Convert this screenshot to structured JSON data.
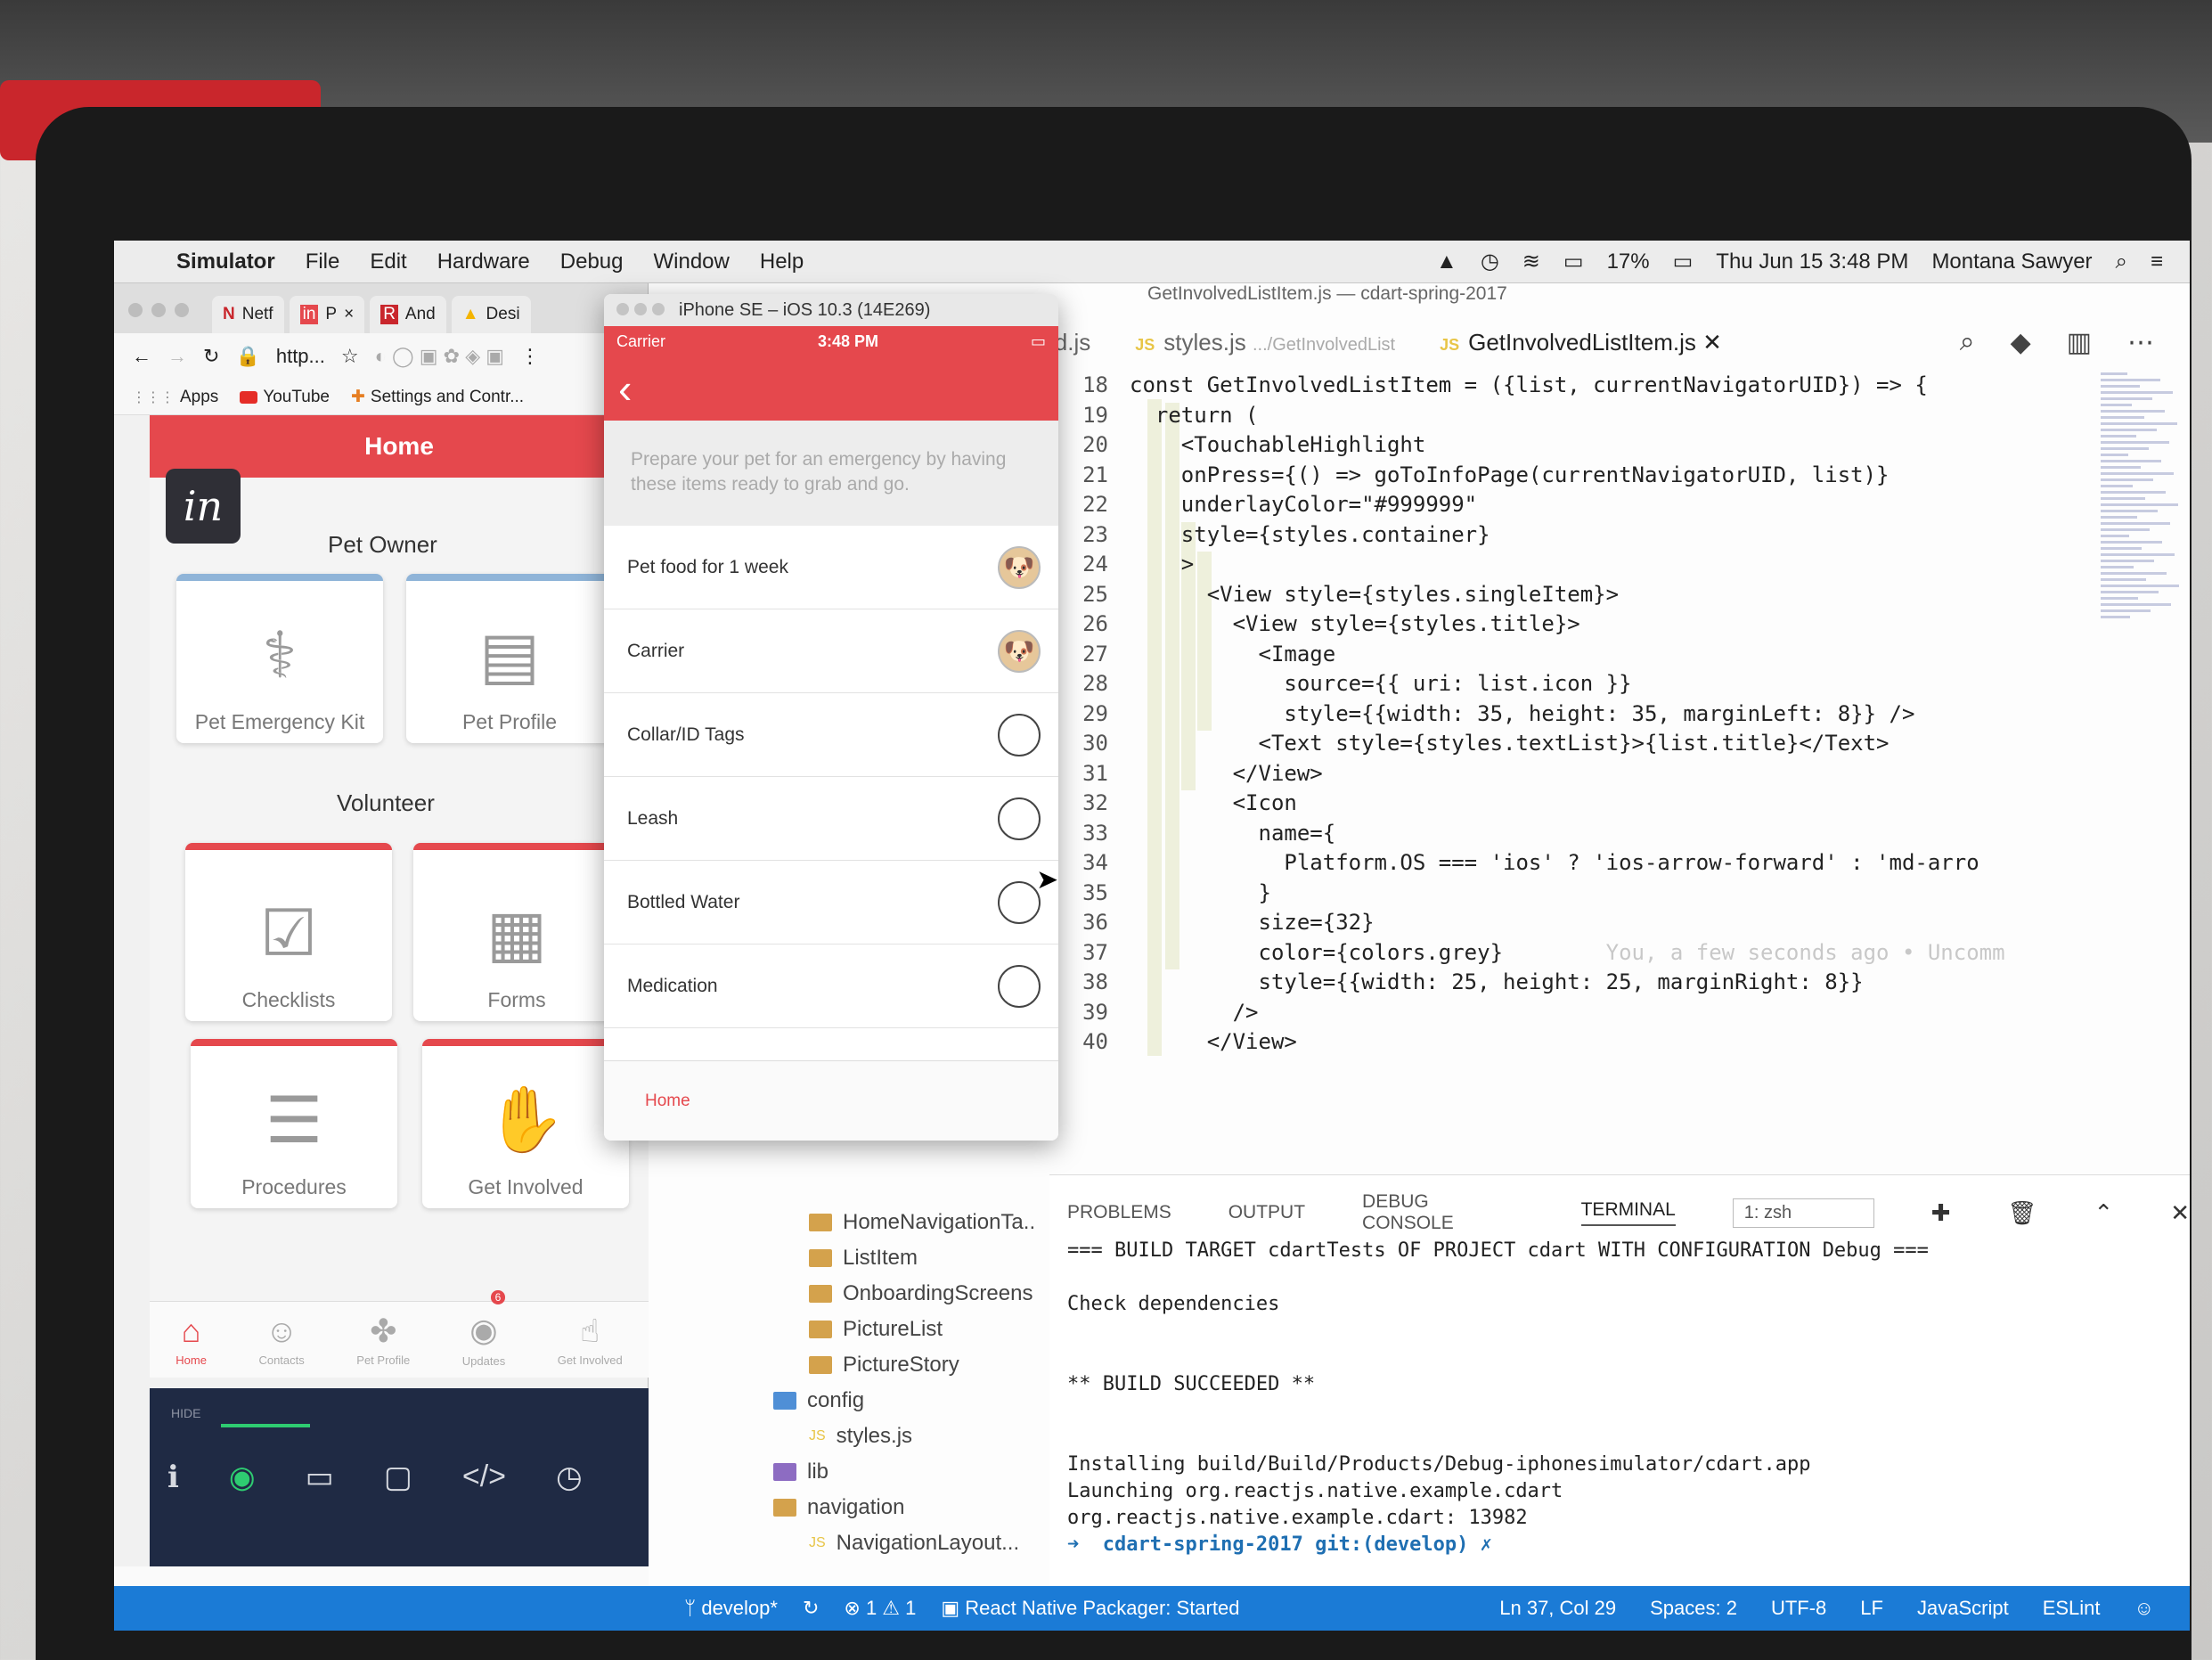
{
  "menubar": {
    "items": [
      "Simulator",
      "File",
      "Edit",
      "Hardware",
      "Debug",
      "Window",
      "Help"
    ],
    "battery": "17%",
    "datetime": "Thu Jun 15  3:48 PM",
    "user": "Montana Sawyer"
  },
  "chrome": {
    "tabs": [
      "Netf",
      "P",
      "And",
      "Desi"
    ],
    "address": "http...",
    "bookmarks": [
      "Apps",
      "YouTube",
      "Settings and Contr..."
    ]
  },
  "invision": {
    "header": "Home",
    "logo": "in",
    "section1": "Pet Owner",
    "section2": "Volunteer",
    "cards": [
      "Pet Emergency Kit",
      "Pet Profile",
      "Checklists",
      "Forms",
      "Procedures",
      "Get Involved"
    ],
    "tabbar": [
      "Home",
      "Contacts",
      "Pet Profile",
      "Updates",
      "Get Involved"
    ],
    "badge": "6",
    "hide_label": "HIDE"
  },
  "iphone": {
    "window_title": "iPhone SE – iOS 10.3 (14E269)",
    "carrier": "Carrier",
    "time": "3:48 PM",
    "intro": "Prepare your pet for an emergency by having these items ready to grab and go.",
    "items": [
      "Pet food for 1 week",
      "Carrier",
      "Collar/ID Tags",
      "Leash",
      "Bottled Water",
      "Medication"
    ],
    "footer_tab": "Home"
  },
  "vscode": {
    "title": "GetInvolvedListItem.js — cdart-spring-2017",
    "tabs": [
      "id.js",
      "styles.js",
      ".../GetInvolvedList",
      "GetInvolvedListItem.js"
    ],
    "code_lines": [
      {
        "n": "18",
        "t": "const GetInvolvedListItem = ({list, currentNavigatorUID}) => {"
      },
      {
        "n": "19",
        "t": "  return ("
      },
      {
        "n": "20",
        "t": "    <TouchableHighlight"
      },
      {
        "n": "21",
        "t": "    onPress={() => goToInfoPage(currentNavigatorUID, list)}"
      },
      {
        "n": "22",
        "t": "    underlayColor=\"#999999\""
      },
      {
        "n": "23",
        "t": "    style={styles.container}"
      },
      {
        "n": "24",
        "t": "    >"
      },
      {
        "n": "25",
        "t": "      <View style={styles.singleItem}>"
      },
      {
        "n": "26",
        "t": "        <View style={styles.title}>"
      },
      {
        "n": "27",
        "t": "          <Image"
      },
      {
        "n": "28",
        "t": "            source={{ uri: list.icon }}"
      },
      {
        "n": "29",
        "t": "            style={{width: 35, height: 35, marginLeft: 8}} />"
      },
      {
        "n": "30",
        "t": "          <Text style={styles.textList}>{list.title}</Text>"
      },
      {
        "n": "31",
        "t": "        </View>"
      },
      {
        "n": "32",
        "t": "        <Icon"
      },
      {
        "n": "33",
        "t": "          name={"
      },
      {
        "n": "34",
        "t": "            Platform.OS === 'ios' ? 'ios-arrow-forward' : 'md-arro"
      },
      {
        "n": "35",
        "t": "          }"
      },
      {
        "n": "36",
        "t": "          size={32}"
      },
      {
        "n": "37",
        "t": "          color={colors.grey}"
      },
      {
        "n": "38",
        "t": "          style={{width: 25, height: 25, marginRight: 8}}"
      },
      {
        "n": "39",
        "t": "        />"
      },
      {
        "n": "40",
        "t": "      </View>"
      }
    ],
    "blame": "You, a few seconds ago • Uncomm",
    "panel_tabs": [
      "PROBLEMS",
      "OUTPUT",
      "DEBUG CONSOLE",
      "TERMINAL"
    ],
    "terminal_select": "1: zsh",
    "terminal_lines": [
      "=== BUILD TARGET cdartTests OF PROJECT cdart WITH CONFIGURATION Debug ===",
      "",
      "Check dependencies",
      "",
      "",
      "** BUILD SUCCEEDED **",
      "",
      "",
      "Installing build/Build/Products/Debug-iphonesimulator/cdart.app",
      "Launching org.reactjs.native.example.cdart",
      "org.reactjs.native.example.cdart: 13982"
    ],
    "prompt": "➜  cdart-spring-2017 git:(develop) ✗",
    "explorer": [
      "HomeNavigationTa..",
      "ListItem",
      "OnboardingScreens",
      "PictureList",
      "PictureStory",
      "config",
      "styles.js",
      "lib",
      "navigation",
      "NavigationLayout..."
    ]
  },
  "statusbar": {
    "branch": "develop*",
    "problems": "⊗ 1  ⚠ 1",
    "packager": "React Native Packager: Started",
    "position": "Ln 37, Col 29",
    "spaces": "Spaces: 2",
    "encoding": "UTF-8",
    "eol": "LF",
    "language": "JavaScript",
    "linter": "ESLint"
  }
}
